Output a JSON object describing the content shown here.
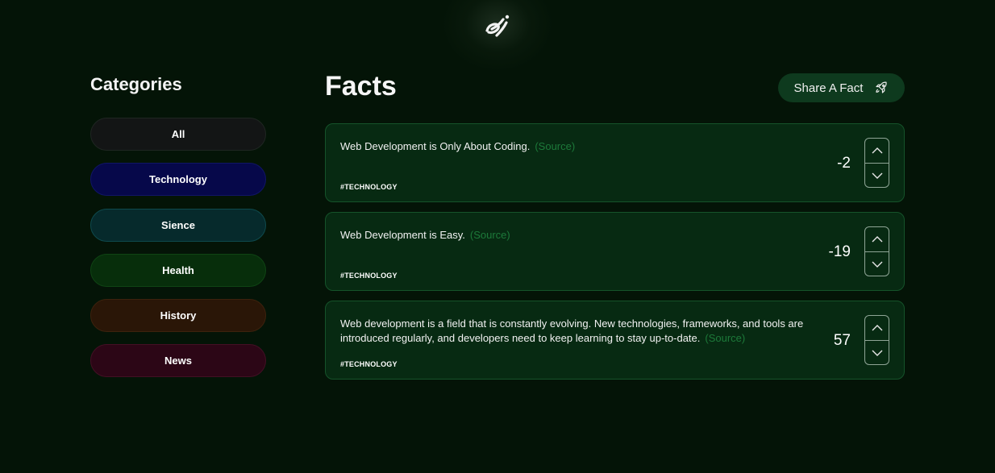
{
  "sidebar": {
    "title": "Categories",
    "categories": [
      {
        "label": "All",
        "color": "#131515"
      },
      {
        "label": "Technology",
        "color": "#06084a"
      },
      {
        "label": "Sience",
        "color": "#062a2c"
      },
      {
        "label": "Health",
        "color": "#072e0b"
      },
      {
        "label": "History",
        "color": "#2a1607"
      },
      {
        "label": "News",
        "color": "#2c0616"
      }
    ]
  },
  "main": {
    "title": "Facts",
    "share_button": {
      "label": "Share A Fact",
      "icon": "rocket-icon"
    },
    "facts": [
      {
        "text": "Web Development is Only About Coding.",
        "source_label": "(Source)",
        "tag": "#TECHNOLOGY",
        "score": "-2"
      },
      {
        "text": "Web Development is Easy.",
        "source_label": "(Source)",
        "tag": "#TECHNOLOGY",
        "score": "-19"
      },
      {
        "text": "Web development is a field that is constantly evolving. New technologies, frameworks, and tools are introduced regularly, and developers need to keep learning to stay up-to-date.",
        "source_label": "(Source)",
        "tag": "#TECHNOLOGY",
        "score": "57"
      }
    ]
  },
  "colors": {
    "background": "#041407",
    "card": "#072a12",
    "source_link": "#1d7a3a",
    "share_button": "#0e3a1e"
  },
  "icons": {
    "logo": "logo-icon",
    "vote_up": "chevron-up-icon",
    "vote_down": "chevron-down-icon"
  }
}
